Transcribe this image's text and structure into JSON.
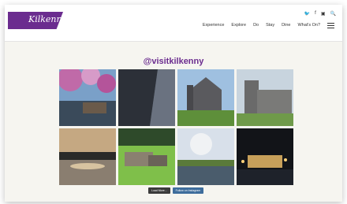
{
  "brand": {
    "logo_text": "Kilkenny",
    "accent": "#6b2c8f"
  },
  "utility_icons": [
    "twitter-icon",
    "facebook-icon",
    "instagram-icon",
    "search-icon"
  ],
  "nav": {
    "items": [
      "Experience",
      "Explore",
      "Do",
      "Stay",
      "Dine",
      "What's On?"
    ]
  },
  "instagram": {
    "handle": "@visitkilkenny"
  },
  "buttons": {
    "load_more": "Load More...",
    "follow": "Follow on Instagram"
  },
  "tiles": [
    "blossom-river-photo",
    "tower-wall-photo",
    "cathedral-photo",
    "castle-photo",
    "sunset-river-photo",
    "donkeys-field-photo",
    "riverside-town-photo",
    "night-castle-photo"
  ]
}
